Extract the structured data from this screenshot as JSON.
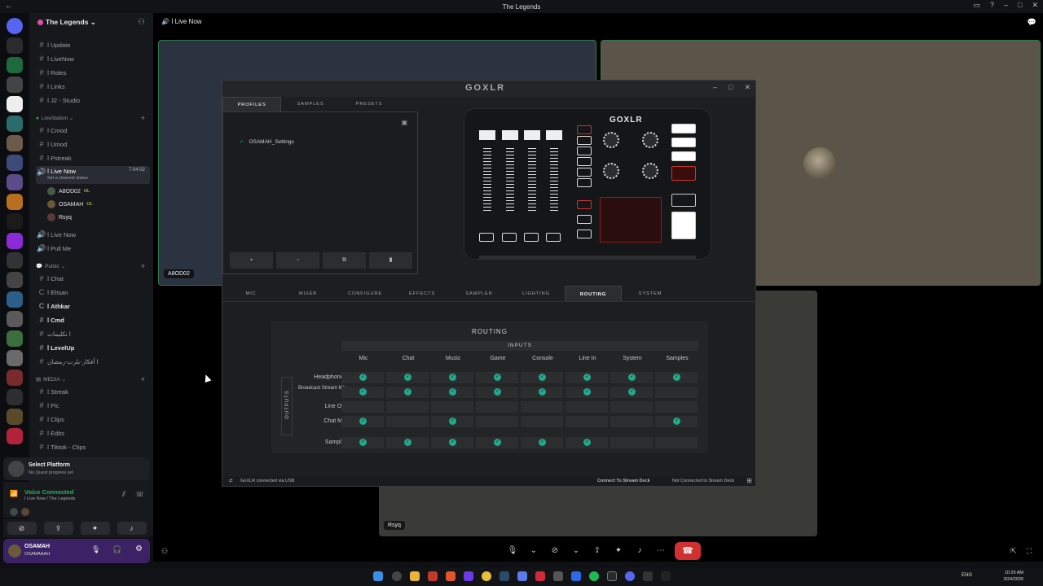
{
  "window": {
    "title": "The Legends"
  },
  "server": {
    "name": "The Legends",
    "channels_top": [
      "ا Update",
      "ا LiveNow",
      "ا Roles",
      "ا Links",
      "ا J2 - Studio"
    ],
    "cat_livestation": "LiveStation",
    "channels_live": [
      "ا Cmod",
      "ا Umod",
      "ا Pstreak"
    ],
    "active_channel": {
      "name": "ا Live Now",
      "time": "7:04:02",
      "status": "Set a channel status"
    },
    "members": [
      {
        "name": "A8OD02",
        "tag": "OL"
      },
      {
        "name": "OSAMAH",
        "tag": "OL"
      },
      {
        "name": "Rsyq",
        "tag": ""
      }
    ],
    "channels_voice2": [
      "ا Live Now",
      "ا Pull Me"
    ],
    "cat_public": "Public",
    "channels_public": [
      "ا Chat",
      "ا Ehsan",
      "ا Athkar",
      "ا Cmd",
      "ا تكليمات",
      "ا LevelUp",
      "ا أفكار-بلرت-رمضان"
    ],
    "cat_media": "MEDIA",
    "channels_media": [
      "ا Streak",
      "ا Pic",
      "ا Clips",
      "ا Edits",
      "ا Tiktok - Clips"
    ]
  },
  "quest": {
    "title": "Select Platform",
    "subtitle": "No Quest progress yet"
  },
  "voice": {
    "status": "Voice Connected",
    "location": "ا Live Now / The Legends"
  },
  "user": {
    "name": "OSAMAH",
    "sub": "OSAMAAAH"
  },
  "main": {
    "header": "ا Live Now",
    "tile_left_name": "A8OD02",
    "tile_bottom_name": "Rsyq"
  },
  "goxlr": {
    "logo": "GOXLR",
    "top_tabs": [
      "PROFILES",
      "SAMPLES",
      "PRESETS"
    ],
    "profile": "OSAMAH_Settings",
    "device_logo": "GOXLR",
    "bottom_tabs": [
      "MIC",
      "MIXER",
      "CONFIGURE",
      "EFFECTS",
      "SAMPLER",
      "LIGHTING",
      "ROUTING",
      "SYSTEM"
    ],
    "selected_tab": "ROUTING",
    "routing": {
      "title": "ROUTING",
      "inputs_label": "INPUTS",
      "outputs_label": "OUTPUTS",
      "inputs": [
        "Mic",
        "Chat",
        "Music",
        "Game",
        "Console",
        "Line In",
        "System",
        "Samples"
      ],
      "outputs": [
        "Headphones",
        "Broadcast Stream Mix",
        "Line Out",
        "Chat Mic"
      ],
      "sampler_label": "Sampler",
      "matrix": [
        [
          1,
          1,
          1,
          1,
          1,
          1,
          1,
          1
        ],
        [
          1,
          1,
          1,
          1,
          1,
          1,
          1,
          0
        ],
        [
          0,
          0,
          0,
          0,
          0,
          0,
          0,
          0
        ],
        [
          1,
          0,
          1,
          0,
          0,
          0,
          0,
          1
        ]
      ],
      "sampler_row": [
        1,
        1,
        1,
        1,
        1,
        1,
        0,
        0
      ]
    },
    "status_left": "GoXLR connected via USB",
    "status_mid": "Connect To Stream Deck",
    "status_right": "Not Connected to Stream Deck"
  },
  "taskbar": {
    "lang": "ENG",
    "time": "10:29 AM",
    "date": "3/24/2026"
  }
}
